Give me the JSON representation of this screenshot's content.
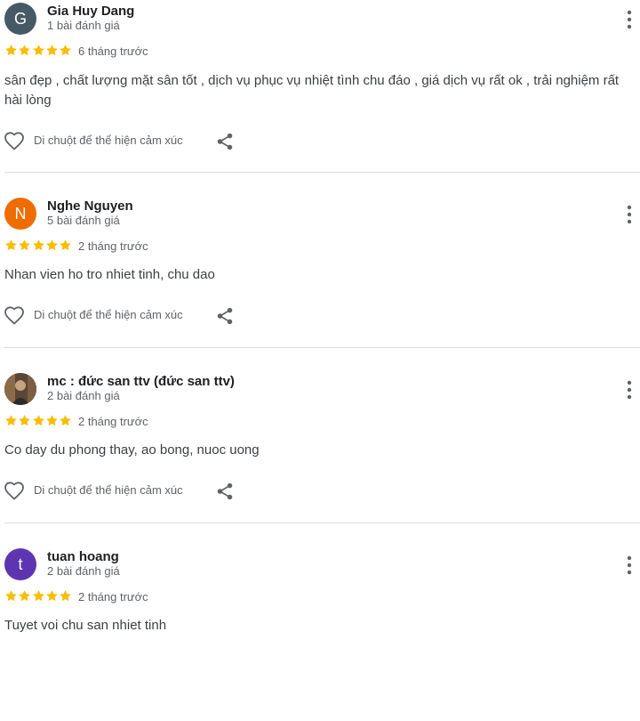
{
  "reviews": [
    {
      "avatar_letter": "G",
      "avatar_color": "#455a64",
      "name": "Gia Huy Dang",
      "review_count": "1 bài đánh giá",
      "rating": 5,
      "date": "6 tháng trước",
      "text": "sân đẹp , chất lượng mặt sân tốt , dịch vụ phục vụ nhiệt tình chu đáo , giá dịch vụ rất ok , trải nghiệm rất hài lòng",
      "reaction_label": "Di chuột để thể hiện cảm xúc"
    },
    {
      "avatar_letter": "N",
      "avatar_color": "#ef6c00",
      "name": "Nghe Nguyen",
      "review_count": "5 bài đánh giá",
      "rating": 5,
      "date": "2 tháng trước",
      "text": "Nhan vien ho tro nhiet tinh, chu dao",
      "reaction_label": "Di chuột để thể hiện cảm xúc"
    },
    {
      "avatar_letter": "",
      "avatar_color": "#6b5a4a",
      "name": "mc : đức san ttv (đức san ttv)",
      "review_count": "2 bài đánh giá",
      "rating": 5,
      "date": "2 tháng trước",
      "text": "Co day du phong thay, ao bong, nuoc uong",
      "reaction_label": "Di chuột để thể hiện cảm xúc"
    },
    {
      "avatar_letter": "t",
      "avatar_color": "#5e35b1",
      "name": "tuan hoang",
      "review_count": "2 bài đánh giá",
      "rating": 5,
      "date": "2 tháng trước",
      "text": "Tuyet voi chu san nhiet tinh",
      "reaction_label": ""
    }
  ],
  "colors": {
    "star": "#fbbc04",
    "icon": "#5f6368",
    "divider": "#dadce0"
  },
  "icons": {
    "menu": "more-vert-icon",
    "like": "heart-outline-icon",
    "share": "share-icon",
    "star": "star-icon"
  }
}
